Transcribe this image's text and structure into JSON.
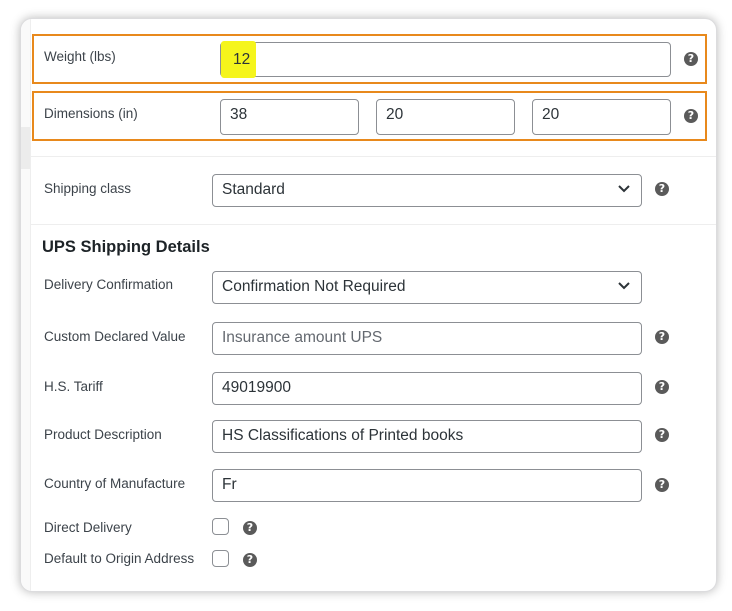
{
  "weight": {
    "label": "Weight (lbs)",
    "value": "12"
  },
  "dimensions": {
    "label": "Dimensions (in)",
    "length": "38",
    "width": "20",
    "height": "20"
  },
  "shipping_class": {
    "label": "Shipping class",
    "selected": "Standard"
  },
  "ups": {
    "heading": "UPS Shipping Details",
    "delivery_confirmation": {
      "label": "Delivery Confirmation",
      "selected": "Confirmation Not Required"
    },
    "custom_declared_value": {
      "label": "Custom Declared Value",
      "placeholder": "Insurance amount UPS"
    },
    "hs_tariff": {
      "label": "H.S. Tariff",
      "value": "49019900"
    },
    "product_description": {
      "label": "Product Description",
      "value": "HS Classifications of Printed books"
    },
    "country_of_manufacture": {
      "label": "Country of Manufacture",
      "value": "Fr"
    },
    "direct_delivery": {
      "label": "Direct Delivery"
    },
    "default_origin": {
      "label": "Default to Origin Address"
    }
  },
  "help_glyph": "?",
  "colors": {
    "highlight_border": "#e8891c",
    "highlight_fill": "#f5f51c",
    "help_icon": "#5a5a5a"
  },
  "icons": [
    "help-icon",
    "chevron-down-icon"
  ]
}
